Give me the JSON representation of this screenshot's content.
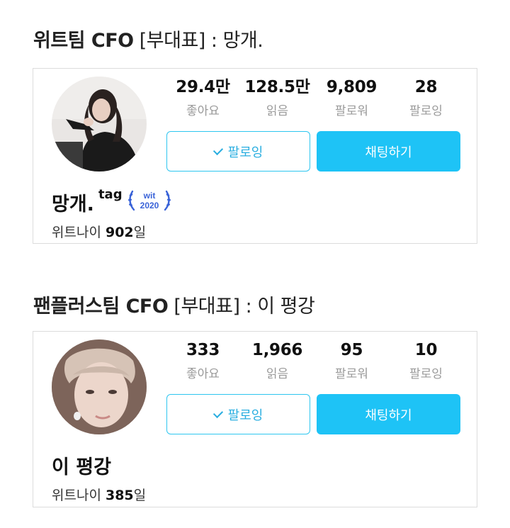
{
  "members": [
    {
      "team_title": "위트팀 CFO",
      "role_title": "[부대표] : 망개.",
      "name": "망개.",
      "tag": "tag",
      "badge": {
        "line1": "wit",
        "line2": "2020",
        "color": "#3a63d8"
      },
      "days_label": "위트나이",
      "days_value": "902",
      "days_unit": "일",
      "stats": [
        {
          "value": "29.4만",
          "label": "좋아요"
        },
        {
          "value": "128.5만",
          "label": "읽음"
        },
        {
          "value": "9,809",
          "label": "팔로워"
        },
        {
          "value": "28",
          "label": "팔로잉"
        }
      ],
      "follow_label": "팔로잉",
      "chat_label": "채팅하기"
    },
    {
      "team_title": "팬플러스팀 CFO",
      "role_title": "[부대표] : 이 평강",
      "name": "이 평강",
      "days_label": "위트나이",
      "days_value": "385",
      "days_unit": "일",
      "stats": [
        {
          "value": "333",
          "label": "좋아요"
        },
        {
          "value": "1,966",
          "label": "읽음"
        },
        {
          "value": "95",
          "label": "팔로워"
        },
        {
          "value": "10",
          "label": "팔로잉"
        }
      ],
      "follow_label": "팔로잉",
      "chat_label": "채팅하기"
    }
  ],
  "colors": {
    "accent": "#1ec3f6",
    "follow_border": "#2ec6f0",
    "label_gray": "#9a9a9a"
  }
}
